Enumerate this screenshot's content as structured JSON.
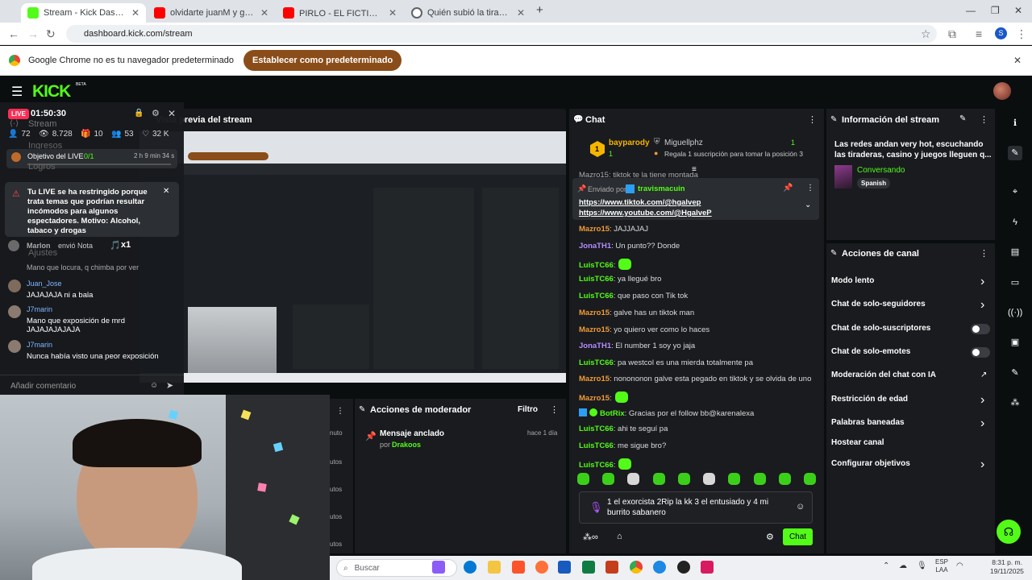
{
  "browser": {
    "tabs": [
      {
        "title": "Stream - Kick Dashboard",
        "active": true,
        "favicon_color": "#53fc18"
      },
      {
        "title": "olvidarte juanM y galvep - YouT",
        "active": false,
        "favicon_color": "#ff0000"
      },
      {
        "title": "PIRLO - EL FICTICIO 🦎 [RIP Bl",
        "active": false,
        "favicon_color": "#ff0000"
      },
      {
        "title": "Quién subió la tiradera",
        "active": false,
        "favicon_color": "#5f6368"
      }
    ],
    "url": "dashboard.kick.com/stream",
    "profile_initial": "S",
    "banner": {
      "message": "Google Chrome no es tu navegador predeterminado",
      "button": "Establecer como predeterminado"
    }
  },
  "kick": {
    "logo": "KICK",
    "logo_badge": "BETA",
    "accent": "#53fc18"
  },
  "overlay": {
    "live_badge": "LIVE",
    "time": "01:50:30",
    "stats": {
      "followers_icon": "72",
      "viewers": "8.728",
      "gifts": "10",
      "subs": "53",
      "likes": "32 K"
    },
    "goal_label": "Objetivo del LIVE",
    "goal_value": "0/1",
    "goal_time": "2 h 9 min 34 s",
    "behind_items": [
      "Stream",
      "Ingresos",
      "Logros",
      "Ajustes"
    ],
    "warning": "Tu LIVE se ha restringido porque trata temas que podrían resultar incómodos para algunos espectadores. Motivo: Alcohol, tabaco y drogas",
    "gift_line_user": "Marlon",
    "gift_line_text": "envió Nota",
    "gift_count": "x1",
    "partial_msg": "Mano que locura, q chimba por ver",
    "comments": [
      {
        "user": "Juan_Jose",
        "text": "JAJAJAJA ni a bala"
      },
      {
        "user": "J7marin",
        "text": "Mano que exposición de mrd JAJAJAJAJAJA"
      },
      {
        "user": "J7marin",
        "text": "Nunca había visto una peor exposición"
      }
    ],
    "comment_placeholder": "Añadir comentario"
  },
  "preview": {
    "title": "Vista previa del stream"
  },
  "moderator": {
    "title": "Acciones de moderador",
    "filter": "Filtro",
    "pinned_label": "Mensaje anclado",
    "pinned_by": "por",
    "pinned_user": "Drakoos",
    "pinned_time": "hace 1 día",
    "side_items": [
      "nuto",
      "utos",
      "utos",
      "utos",
      "utos"
    ]
  },
  "chat": {
    "title": "Chat",
    "top_gifter": {
      "rank": "1",
      "name": "bayparody",
      "count": "1"
    },
    "second": {
      "name": "Miguellphz",
      "count": "1",
      "promo": "Regala 1 suscripción para tomar la posición 3"
    },
    "partial_top": "Mazro15: tiktok te la tiene montada",
    "pinned": {
      "sent_by": "Enviado por",
      "user": "travismacuin",
      "link1": "https://www.tiktok.com/@hgalvep",
      "link2": "https://www.youtube.com/@HgalveP"
    },
    "messages": [
      {
        "user": "Mazro15",
        "color": "or",
        "text": ": JAJJAJAJ"
      },
      {
        "user": "JonaTH1",
        "color": "pu",
        "text": ": Un punto?? Donde"
      },
      {
        "user": "LuisTC66",
        "color": "gr",
        "text": ":",
        "emote": true
      },
      {
        "user": "LuisTC66",
        "color": "gr",
        "text": ": ya llegué bro"
      },
      {
        "user": "LuisTC66",
        "color": "gr",
        "text": ": que paso con Tik tok"
      },
      {
        "user": "Mazro15",
        "color": "or",
        "text": ": galve has un tiktok man"
      },
      {
        "user": "Mazro15",
        "color": "or",
        "text": ": yo quiero ver como lo haces"
      },
      {
        "user": "JonaTH1",
        "color": "pu",
        "text": ": El number 1 soy yo jaja"
      },
      {
        "user": "LuisTC66",
        "color": "gr",
        "text": ": pa westcol es una mierda totalmente pa"
      },
      {
        "user": "Mazro15",
        "color": "or",
        "text": ": nonononon galve esta pegado en tiktok y se olvida de uno"
      },
      {
        "user": "Mazro15",
        "color": "or",
        "text": ":",
        "emote": true
      },
      {
        "user": "BotRix",
        "color": "gr",
        "text": ": Gracias por el follow bb@karenalexa"
      },
      {
        "user": "LuisTC66",
        "color": "gr",
        "text": ": ahi te seguí pa"
      },
      {
        "user": "LuisTC66",
        "color": "gr",
        "text": ": me sigue bro?"
      },
      {
        "user": "LuisTC66",
        "color": "gr",
        "text": ":",
        "emote": true
      }
    ],
    "input_text": "1 el exorcista 2Rip la kk 3 el entusiado y 4 mi burrito sabanero",
    "send_button": "Chat"
  },
  "stream_info": {
    "title": "Información del stream",
    "description": "Las redes andan very hot, escuchando las tiraderas, casino y juegos lleguen q...",
    "category": "Conversando",
    "language": "Spanish"
  },
  "channel_actions": {
    "title": "Acciones de canal",
    "items": [
      {
        "label": "Modo lento",
        "kind": "chevron"
      },
      {
        "label": "Chat de solo-seguidores",
        "kind": "chevron"
      },
      {
        "label": "Chat de solo-suscriptores",
        "kind": "toggle"
      },
      {
        "label": "Chat de solo-emotes",
        "kind": "toggle"
      },
      {
        "label": "Moderación del chat con IA",
        "kind": "external"
      },
      {
        "label": "Restricción de edad",
        "kind": "chevron"
      },
      {
        "label": "Palabras baneadas",
        "kind": "chevron"
      },
      {
        "label": "Hostear canal",
        "kind": "none"
      },
      {
        "label": "Configurar objetivos",
        "kind": "chevron"
      }
    ]
  },
  "taskbar": {
    "search_placeholder": "Buscar",
    "lang": "ESP",
    "lang2": "LAA",
    "time": "8:31 p. m.",
    "date": "19/11/2025"
  }
}
